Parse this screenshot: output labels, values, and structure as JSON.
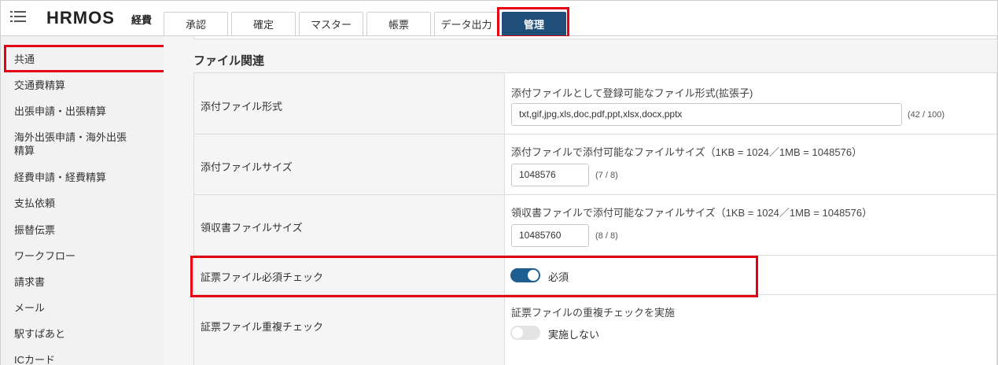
{
  "header": {
    "logo": "HRMOS",
    "logo_sub": "経費",
    "tabs": [
      {
        "label": "承認"
      },
      {
        "label": "確定"
      },
      {
        "label": "マスター"
      },
      {
        "label": "帳票"
      },
      {
        "label": "データ出力"
      },
      {
        "label": "管理",
        "active": true
      }
    ]
  },
  "sidebar": {
    "items": [
      {
        "label": "共通",
        "active": true
      },
      {
        "label": "交通費精算"
      },
      {
        "label": "出張申請・出張精算"
      },
      {
        "label": "海外出張申請・海外出張"
      },
      {
        "label": "精算"
      },
      {
        "label": "経費申請・経費精算"
      },
      {
        "label": "支払依頼"
      },
      {
        "label": "振替伝票"
      },
      {
        "label": "ワークフロー"
      },
      {
        "label": "請求書"
      },
      {
        "label": "メール"
      },
      {
        "label": "駅すぱあと"
      },
      {
        "label": "ICカード"
      }
    ]
  },
  "section": {
    "title": "ファイル関連",
    "rows": [
      {
        "label": "添付ファイル形式",
        "description": "添付ファイルとして登録可能なファイル形式(拡張子)",
        "value": "txt,gif,jpg,xls,doc,pdf,ppt,xlsx,docx,pptx",
        "counter": "(42 / 100)"
      },
      {
        "label": "添付ファイルサイズ",
        "description": "添付ファイルで添付可能なファイルサイズ（1KB = 1024／1MB = 1048576）",
        "value": "1048576",
        "counter": "(7 / 8)"
      },
      {
        "label": "領収書ファイルサイズ",
        "description": "領収書ファイルで添付可能なファイルサイズ（1KB = 1024／1MB = 1048576）",
        "value": "10485760",
        "counter": "(8 / 8)"
      },
      {
        "label": "証票ファイル必須チェック",
        "toggle_on": true,
        "toggle_label": "必須"
      },
      {
        "label": "証票ファイル重複チェック",
        "description": "証票ファイルの重複チェックを実施",
        "toggle_on": false,
        "toggle_label": "実施しない"
      }
    ]
  },
  "colors": {
    "accent": "#1f4e79",
    "highlight": "#e60012",
    "toggle_on": "#1f5e91"
  }
}
